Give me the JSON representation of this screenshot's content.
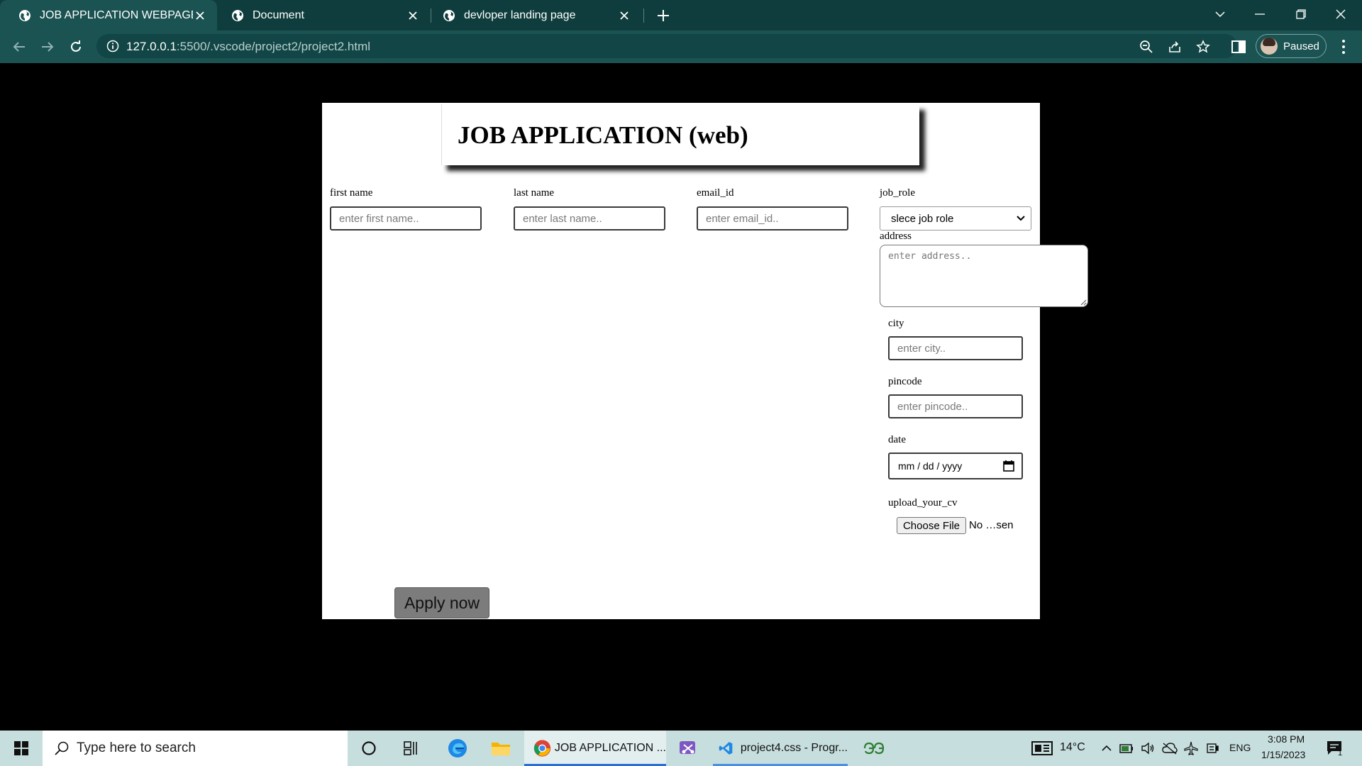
{
  "browser": {
    "tabs": [
      {
        "title": "JOB APPLICATION WEBPAGE",
        "active": true
      },
      {
        "title": "Document",
        "active": false
      },
      {
        "title": "devloper landing page",
        "active": false
      }
    ],
    "url_host": "127.0.0.1",
    "url_rest": ":5500/.vscode/project2/project2.html",
    "profile_status": "Paused"
  },
  "form": {
    "title": "JOB APPLICATION (web)",
    "first_name": {
      "label": "first name",
      "placeholder": "enter first name.."
    },
    "last_name": {
      "label": "last name",
      "placeholder": "enter last name.."
    },
    "email": {
      "label": "email_id",
      "placeholder": "enter email_id.."
    },
    "job_role": {
      "label": "job_role",
      "selected": "slece job role"
    },
    "address": {
      "label": "address",
      "placeholder": "enter address.."
    },
    "city": {
      "label": "city",
      "placeholder": "enter city.."
    },
    "pincode": {
      "label": "pincode",
      "placeholder": "enter pincode.."
    },
    "date": {
      "label": "date",
      "value": "mm / dd / yyyy"
    },
    "cv": {
      "label": "upload_your_cv",
      "button": "Choose File",
      "status": "No …sen"
    },
    "submit_label": "Apply now"
  },
  "taskbar": {
    "search_placeholder": "Type here to search",
    "apps": [
      {
        "label": "JOB APPLICATION ...",
        "icon": "chrome-icon"
      },
      {
        "label": "project4.css - Progr...",
        "icon": "vscode-icon"
      }
    ],
    "weather": "14°C",
    "language": "ENG",
    "time": "3:08 PM",
    "date": "1/15/2023",
    "notification_count": "1"
  }
}
